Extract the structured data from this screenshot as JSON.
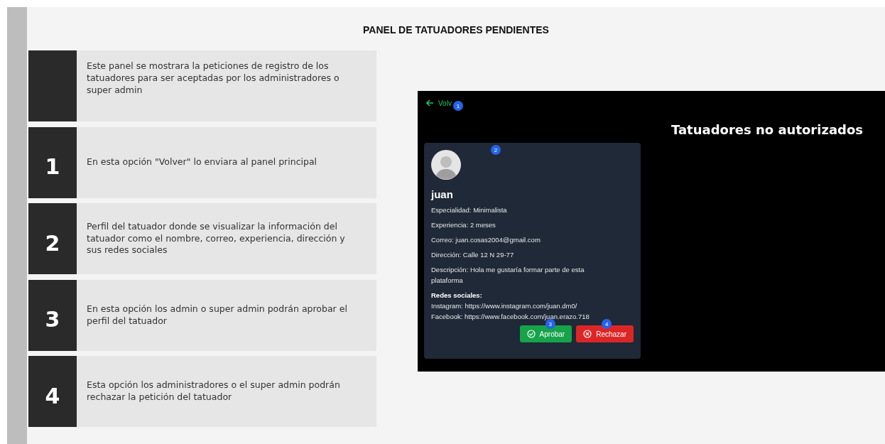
{
  "title": "PANEL DE TATUADORES PENDIENTES",
  "steps": [
    {
      "text": "Este panel se mostrara la peticiones de registro de los tatuadores para ser aceptadas por los administradores o super admin"
    },
    {
      "number": "1",
      "text": "En esta opción \"Volver\" lo enviara al panel principal"
    },
    {
      "number": "2",
      "text": "Perfil del tatuador donde se visualizar la información del tatuador como el nombre, correo, experiencia, dirección y sus redes sociales"
    },
    {
      "number": "3",
      "text": "En esta opción los admin o super admin podrán aprobar el perfil del tatuador"
    },
    {
      "number": "4",
      "text": "Esta opción los administradores o el super admin podrán rechazar la petición del tatuador"
    }
  ],
  "screenshot": {
    "back_link": {
      "label": "Volv",
      "badge": "1"
    },
    "heading": "Tatuadores no autorizados",
    "card": {
      "badge": "2",
      "name": "juan",
      "fields": [
        "Especialidad: Minimalista",
        "Experiencia: 2 meses",
        "Correo: juan.cosas2004@gmail.com",
        "Dirección: Calle 12 N 29-77",
        "Descripción: Hola me gustaría formar parte de esta plataforma"
      ],
      "social_heading": "Redes sociales:",
      "social": [
        "Instagram: https://www.instagram.com/juan.dm0/",
        "Facebook: https://www.facebook.com/juan.erazo.718"
      ],
      "buttons": [
        {
          "kind": "approve",
          "label": "Aprobar",
          "badge": "3"
        },
        {
          "kind": "reject",
          "label": "Rechazar",
          "badge": "4"
        }
      ]
    }
  }
}
